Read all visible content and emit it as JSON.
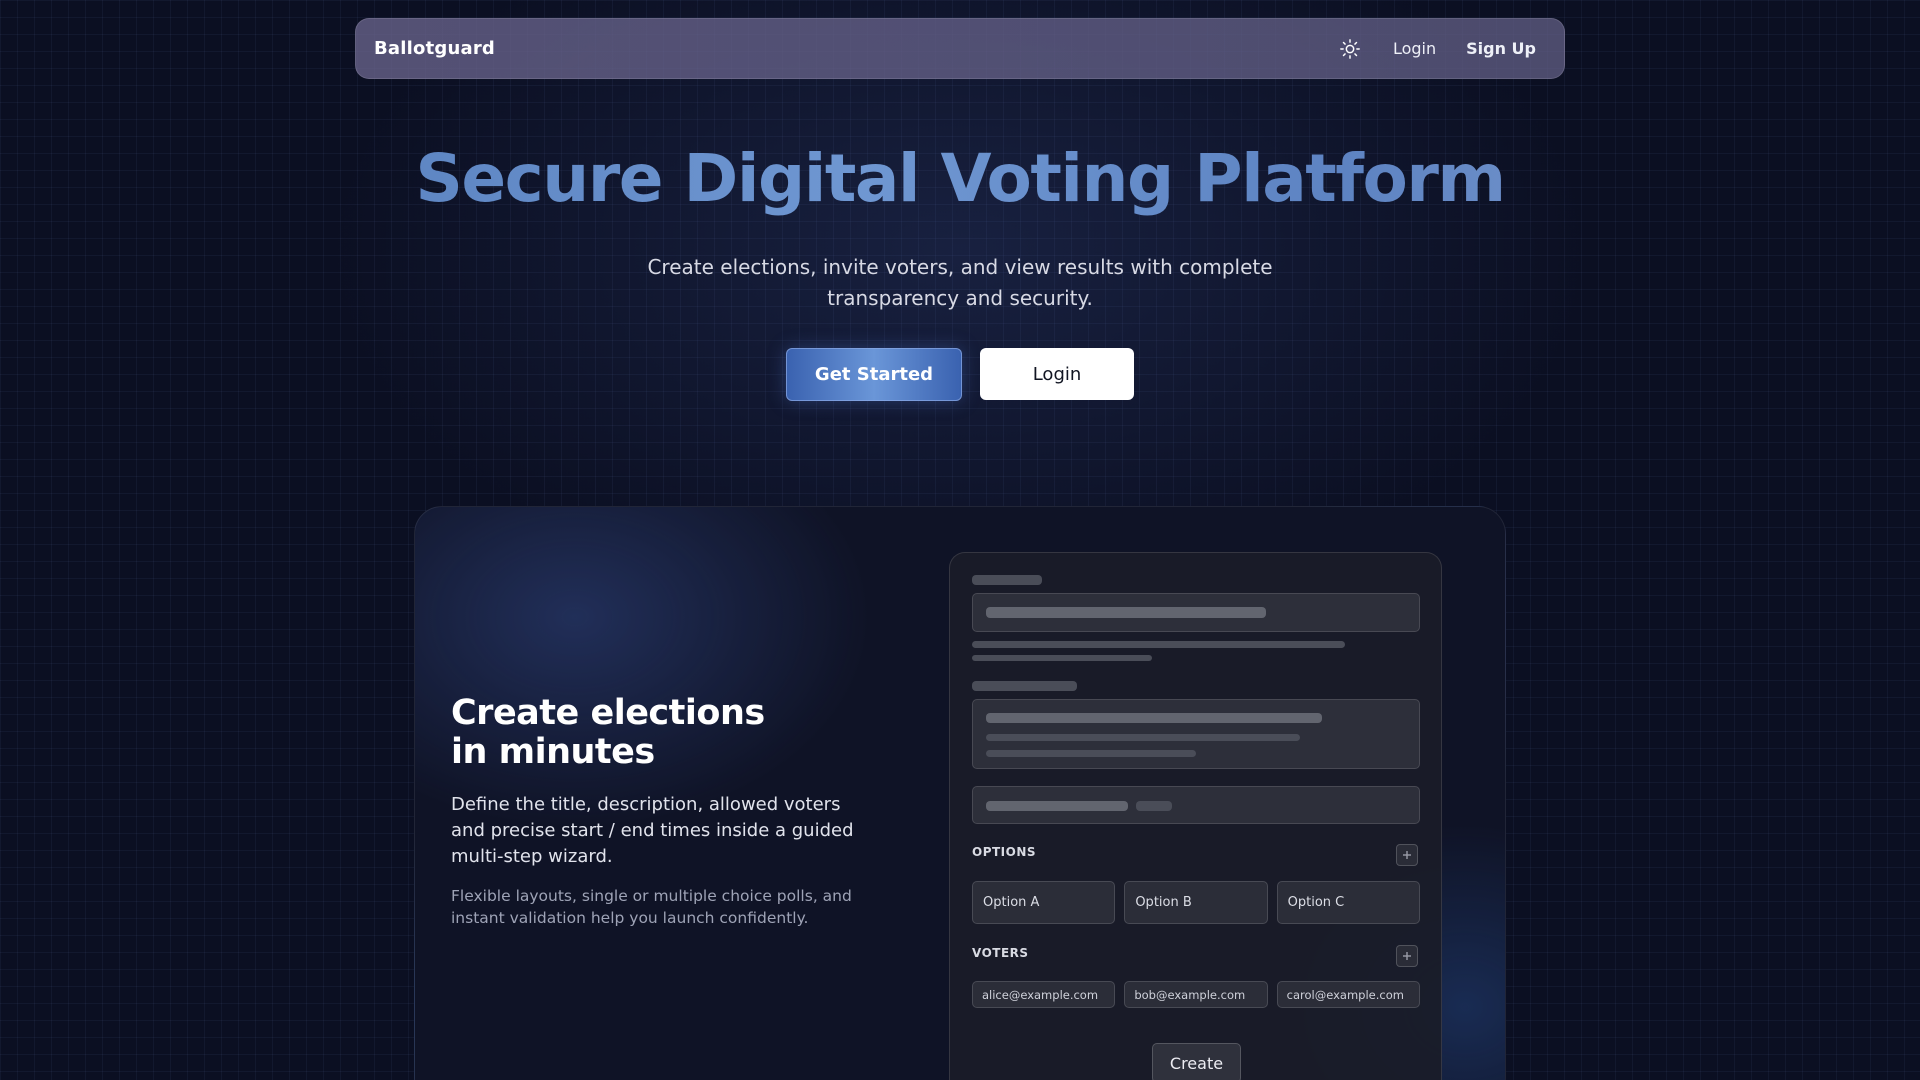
{
  "nav": {
    "brand": "Ballotguard",
    "theme_icon": "sun-icon",
    "login_label": "Login",
    "signup_label": "Sign Up"
  },
  "hero": {
    "title": "Secure Digital Voting Platform",
    "subtitle": "Create elections, invite voters, and view results with complete transparency and security.",
    "primary_button": "Get Started",
    "secondary_button": "Login"
  },
  "feature": {
    "heading": "Create elections in minutes",
    "description": "Define the title, description, allowed voters and precise start / end times inside a guided multi-step wizard.",
    "note": "Flexible layouts, single or multiple choice polls, and instant validation help you launch confidently."
  },
  "mock_form": {
    "options_label": "OPTIONS",
    "options": [
      "Option A",
      "Option B",
      "Option C"
    ],
    "voters_label": "VOTERS",
    "voters": [
      "alice@example.com",
      "bob@example.com",
      "carol@example.com"
    ],
    "add_icon": "plus-icon",
    "create_label": "Create"
  },
  "colors": {
    "background": "#0b0f22",
    "accent": "#5d83c2",
    "button_primary": "#4a74c2",
    "card": "#0f1326"
  }
}
